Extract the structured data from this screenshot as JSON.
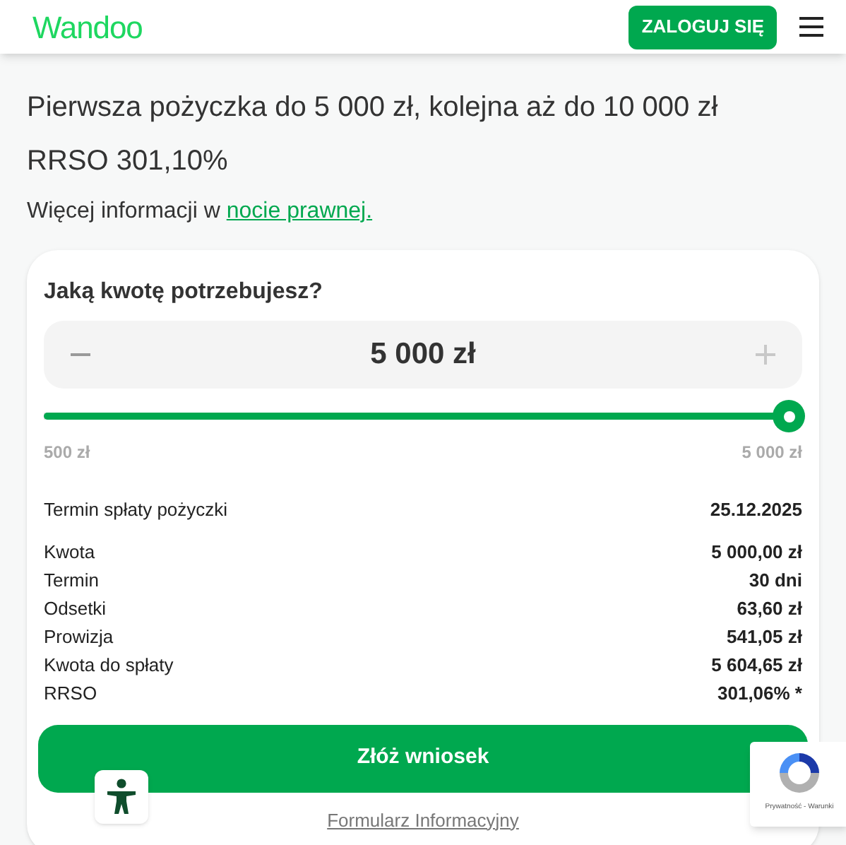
{
  "header": {
    "logo": "Wandoo",
    "login_button": "ZALOGUJ SIĘ"
  },
  "headline": "Pierwsza pożyczka do 5 000 zł, kolejna aż do 10 000 zł",
  "rrso": "RRSO 301,10%",
  "info": {
    "text": "Więcej informacji w",
    "link": "nocie prawnej."
  },
  "calculator": {
    "question": "Jaką kwotę potrzebujesz?",
    "decrease": {
      "disabled": false
    },
    "increase": {
      "disabled": true
    },
    "amount": "5 000 zł",
    "slider": {
      "level": 1,
      "min_label": "500 zł",
      "max_label": "5 000 zł"
    },
    "due_date": {
      "label": "Termin spłaty pożyczki",
      "value": "25.12.2025"
    },
    "details": [
      {
        "label": "Kwota",
        "value": "5 000,00 zł"
      },
      {
        "label": "Termin",
        "value": "30 dni"
      },
      {
        "label": "Odsetki",
        "value": "63,60 zł"
      },
      {
        "label": "Prowizja",
        "value": "541,05 zł"
      },
      {
        "label": "Kwota do spłaty",
        "value": "5 604,65 zł"
      },
      {
        "label": "RRSO",
        "value": "301,06% *"
      }
    ],
    "submit_button": "Złóż wniosek",
    "form_link": "Formularz Informacyjny"
  },
  "recaptcha": {
    "text": "Prywatność - Warunki"
  }
}
